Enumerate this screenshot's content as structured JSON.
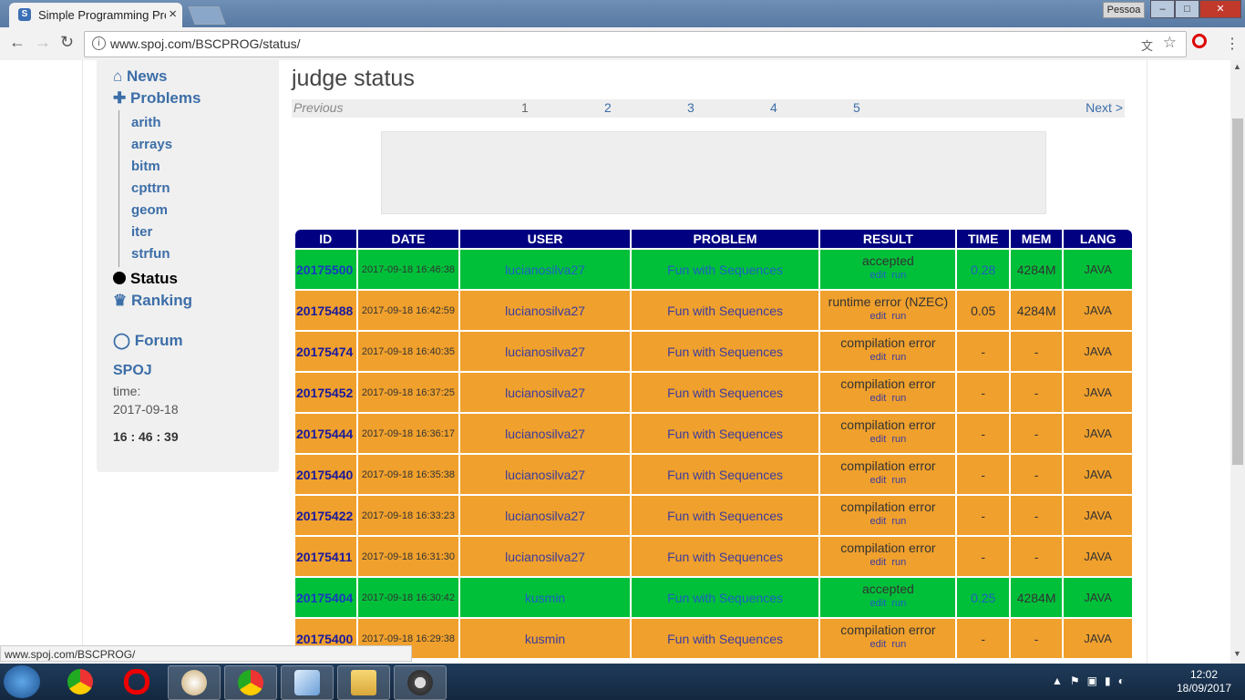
{
  "browser": {
    "tab_title": "Simple Programming Pro",
    "tab_close": "×",
    "favicon_letter": "S",
    "profile_name": "Pessoa",
    "url": "www.spoj.com/BSCPROG/status/",
    "status_url": "www.spoj.com/BSCPROG/",
    "back_glyph": "←",
    "forward_glyph": "→",
    "reload_glyph": "↻",
    "info_glyph": "i",
    "translate_glyph": "文",
    "star_glyph": "☆",
    "menu_glyph": "⋮",
    "minimize_glyph": "–",
    "maximize_glyph": "□",
    "close_glyph": "✕"
  },
  "sidebar": {
    "news": "News",
    "problems": "Problems",
    "sub_items": [
      "arith",
      "arrays",
      "bitm",
      "cpttrn",
      "geom",
      "iter",
      "strfun"
    ],
    "status": "Status",
    "ranking": "Ranking",
    "forum": "Forum",
    "site": "SPOJ",
    "time_label": "time:",
    "date": "2017-09-18",
    "clock": "16 : 46 : 39"
  },
  "main": {
    "heading": "judge status",
    "pager": {
      "previous": "Previous",
      "pages": [
        "1",
        "2",
        "3",
        "4",
        "5"
      ],
      "next": "Next >"
    }
  },
  "table": {
    "headers": [
      "ID",
      "DATE",
      "USER",
      "PROBLEM",
      "RESULT",
      "TIME",
      "MEM",
      "LANG"
    ],
    "edit_label": "edit",
    "run_label": "run",
    "rows": [
      {
        "id": "20175500",
        "date": "2017-09-18 16:46:38",
        "user": "lucianosilva27",
        "problem": "Fun with Sequences",
        "result": "accepted",
        "time": "0.28",
        "mem": "4284M",
        "lang": "JAVA",
        "ok": true
      },
      {
        "id": "20175488",
        "date": "2017-09-18 16:42:59",
        "user": "lucianosilva27",
        "problem": "Fun with Sequences",
        "result": "runtime error (NZEC)",
        "time": "0.05",
        "mem": "4284M",
        "lang": "JAVA",
        "ok": false
      },
      {
        "id": "20175474",
        "date": "2017-09-18 16:40:35",
        "user": "lucianosilva27",
        "problem": "Fun with Sequences",
        "result": "compilation error",
        "time": "-",
        "mem": "-",
        "lang": "JAVA",
        "ok": false
      },
      {
        "id": "20175452",
        "date": "2017-09-18 16:37:25",
        "user": "lucianosilva27",
        "problem": "Fun with Sequences",
        "result": "compilation error",
        "time": "-",
        "mem": "-",
        "lang": "JAVA",
        "ok": false
      },
      {
        "id": "20175444",
        "date": "2017-09-18 16:36:17",
        "user": "lucianosilva27",
        "problem": "Fun with Sequences",
        "result": "compilation error",
        "time": "-",
        "mem": "-",
        "lang": "JAVA",
        "ok": false
      },
      {
        "id": "20175440",
        "date": "2017-09-18 16:35:38",
        "user": "lucianosilva27",
        "problem": "Fun with Sequences",
        "result": "compilation error",
        "time": "-",
        "mem": "-",
        "lang": "JAVA",
        "ok": false
      },
      {
        "id": "20175422",
        "date": "2017-09-18 16:33:23",
        "user": "lucianosilva27",
        "problem": "Fun with Sequences",
        "result": "compilation error",
        "time": "-",
        "mem": "-",
        "lang": "JAVA",
        "ok": false
      },
      {
        "id": "20175411",
        "date": "2017-09-18 16:31:30",
        "user": "lucianosilva27",
        "problem": "Fun with Sequences",
        "result": "compilation error",
        "time": "-",
        "mem": "-",
        "lang": "JAVA",
        "ok": false
      },
      {
        "id": "20175404",
        "date": "2017-09-18 16:30:42",
        "user": "kusmin",
        "problem": "Fun with Sequences",
        "result": "accepted",
        "time": "0.25",
        "mem": "4284M",
        "lang": "JAVA",
        "ok": true
      },
      {
        "id": "20175400",
        "date": "2017-09-18 16:29:38",
        "user": "kusmin",
        "problem": "Fun with Sequences",
        "result": "compilation error",
        "time": "-",
        "mem": "-",
        "lang": "JAVA",
        "ok": false
      }
    ]
  },
  "taskbar": {
    "clock_time": "12:02",
    "clock_date": "18/09/2017",
    "apps": [
      "chrome-icon",
      "opera-icon",
      "paint-icon",
      "chrome-icon",
      "virtualbox-icon",
      "file-explorer-icon",
      "steam-icon"
    ]
  },
  "colors": {
    "accepted": "#00c03a",
    "error": "#f0a02c",
    "header": "#000080",
    "link": "#3c6ea8"
  }
}
